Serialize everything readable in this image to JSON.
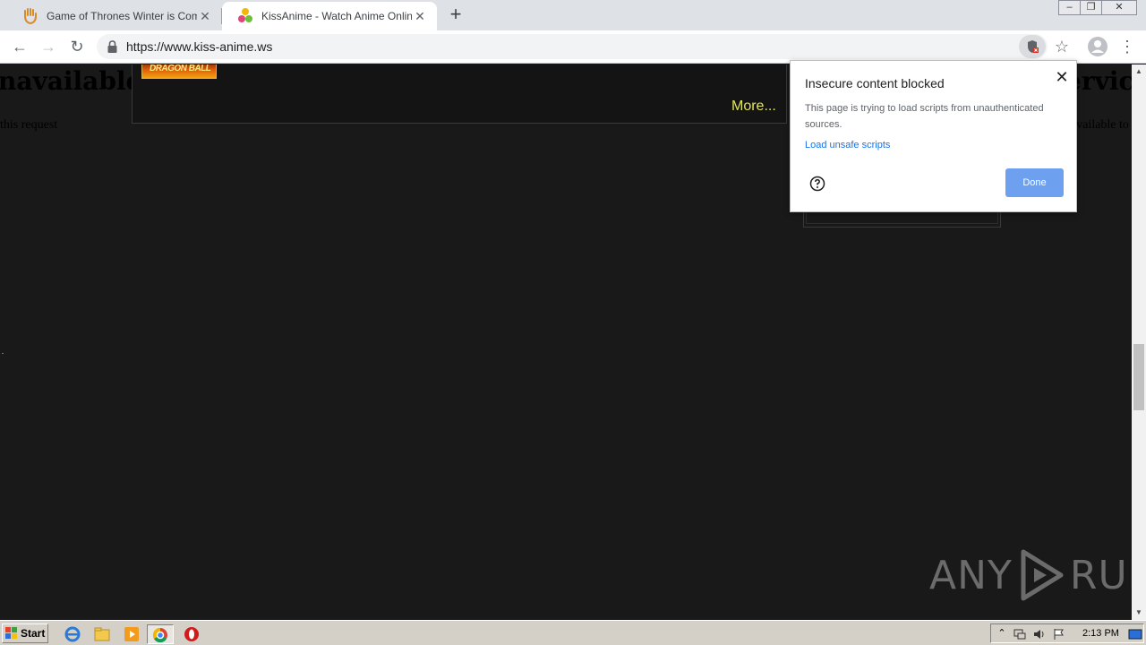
{
  "browser": {
    "tabs": [
      {
        "title": "Game of Thrones Winter is Coming",
        "close": "✕",
        "favicon": "hand-icon"
      },
      {
        "title": "KissAnime - Watch Anime Online English",
        "close": "✕",
        "favicon": "kissanime-icon",
        "active": true
      }
    ],
    "new_tab": "+",
    "window_controls": [
      "–",
      "❐",
      "✕"
    ],
    "url": "https://www.kiss-anime.ws",
    "icons": {
      "back": "←",
      "forward": "→",
      "reload": "↻",
      "star": "☆",
      "menu": "⋮"
    }
  },
  "page": {
    "error_title_left": "navailable",
    "error_sub_left": "this request",
    "error_title_right": "ervic",
    "error_sub_right": "available to",
    "thumb_label": "DRAGON BALL",
    "more_link": "More..."
  },
  "popup": {
    "title": "Insecure content blocked",
    "body": "This page is trying to load scripts from unauthenticated sources.",
    "link": "Load unsafe scripts",
    "done": "Done",
    "close": "✕"
  },
  "watermark": {
    "left": "ANY",
    "right": "RUN"
  },
  "scrollbar": {
    "up": "▲",
    "down": "▼"
  },
  "taskbar": {
    "start": "Start",
    "clock": "2:13 PM"
  },
  "colors": {
    "accent": "#1a73e8",
    "done_button": "#6da1f0",
    "page_bg": "#191919",
    "more_link": "#e2e45a"
  }
}
